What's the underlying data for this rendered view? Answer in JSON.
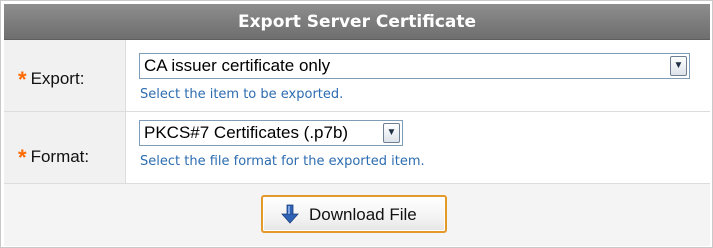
{
  "title": "Export Server Certificate",
  "export": {
    "required_mark": "*",
    "label": "Export:",
    "value": "CA issuer certificate only",
    "hint": "Select the item to be exported."
  },
  "format": {
    "required_mark": "*",
    "label": "Format:",
    "value": "PKCS#7 Certificates (.p7b)",
    "hint": "Select the file format for the exported item."
  },
  "download_button": {
    "label": "Download File",
    "icon": "download-arrow-icon"
  },
  "colors": {
    "title_bar": "#7d7d7d",
    "required": "#ff6a00",
    "hint_text": "#2d6cb0",
    "button_border": "#e39a2b",
    "download_arrow": "#2f63b8"
  }
}
